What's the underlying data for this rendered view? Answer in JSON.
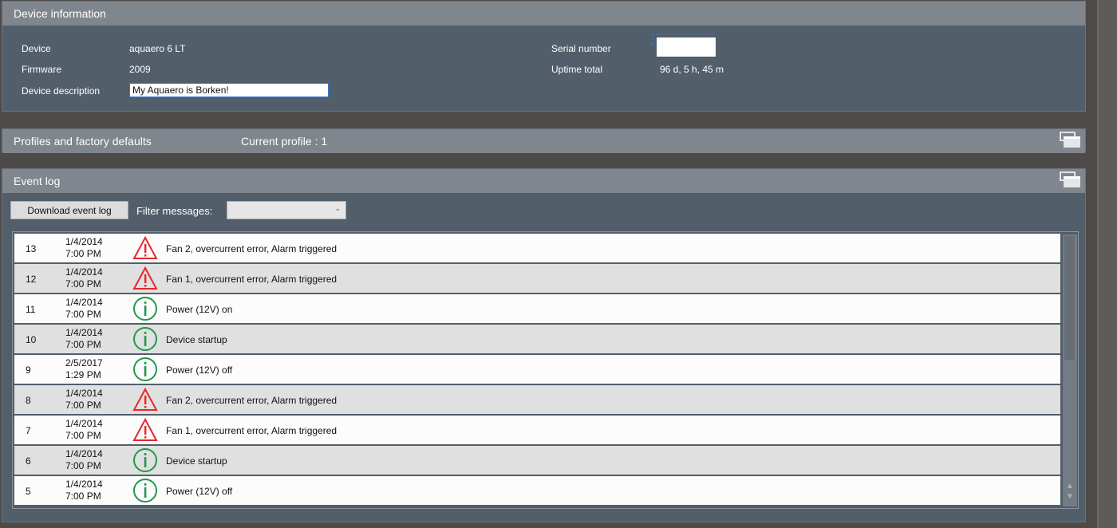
{
  "device_info": {
    "title": "Device information",
    "device_label": "Device",
    "device_value": "aquaero 6 LT",
    "firmware_label": "Firmware",
    "firmware_value": "2009",
    "description_label": "Device description",
    "description_value": "My Aquaero is Borken!",
    "serial_label": "Serial number",
    "uptime_label": "Uptime total",
    "uptime_value": "96 d, 5 h, 45 m"
  },
  "profiles": {
    "title": "Profiles and factory defaults",
    "current_profile": "Current profile : 1"
  },
  "event_log": {
    "title": "Event log",
    "download_label": "Download event log",
    "filter_label": "Filter messages:",
    "filter_value": "",
    "rows": [
      {
        "id": "13",
        "date": "1/4/2014",
        "time": "7:00 PM",
        "type": "warning",
        "message": "Fan 2, overcurrent error, Alarm triggered"
      },
      {
        "id": "12",
        "date": "1/4/2014",
        "time": "7:00 PM",
        "type": "warning",
        "message": "Fan 1, overcurrent error, Alarm triggered"
      },
      {
        "id": "11",
        "date": "1/4/2014",
        "time": "7:00 PM",
        "type": "info",
        "message": "Power (12V) on"
      },
      {
        "id": "10",
        "date": "1/4/2014",
        "time": "7:00 PM",
        "type": "info",
        "message": "Device startup"
      },
      {
        "id": "9",
        "date": "2/5/2017",
        "time": "1:29 PM",
        "type": "info",
        "message": "Power (12V) off"
      },
      {
        "id": "8",
        "date": "1/4/2014",
        "time": "7:00 PM",
        "type": "warning",
        "message": "Fan 2, overcurrent error, Alarm triggered"
      },
      {
        "id": "7",
        "date": "1/4/2014",
        "time": "7:00 PM",
        "type": "warning",
        "message": "Fan 1, overcurrent error, Alarm triggered"
      },
      {
        "id": "6",
        "date": "1/4/2014",
        "time": "7:00 PM",
        "type": "info",
        "message": "Device startup"
      },
      {
        "id": "5",
        "date": "1/4/2014",
        "time": "7:00 PM",
        "type": "info",
        "message": "Power (12V) off"
      }
    ]
  },
  "colors": {
    "warning": "#e8262a",
    "info": "#1f9a4a"
  }
}
